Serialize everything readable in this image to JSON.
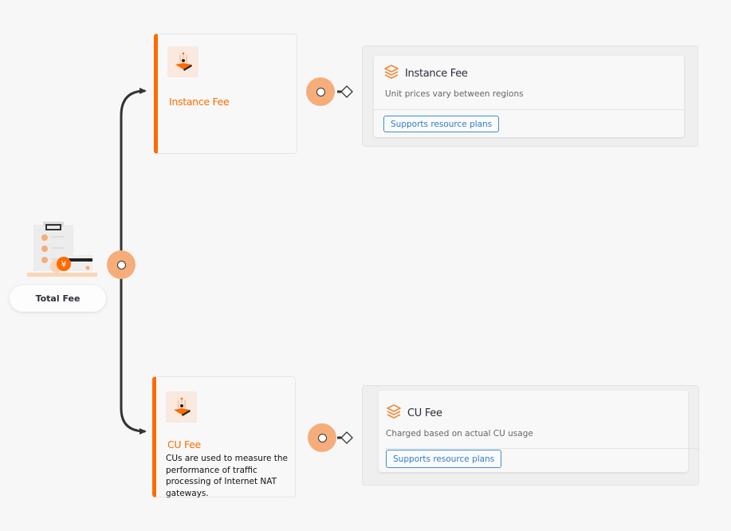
{
  "root": {
    "label": "Total Fee",
    "icon": "bill-payment-icon",
    "currency_symbol": "¥"
  },
  "colors": {
    "accent": "#ff6a00",
    "junction": "#f5ad7a",
    "line": "#333333",
    "link": "#2f7fc7",
    "icon_bg": "#f9e9df"
  },
  "branches": [
    {
      "card": {
        "title": "Instance Fee",
        "description": "",
        "icon": "instance-cube-icon"
      },
      "detail": {
        "title": "Instance Fee",
        "icon": "layers-icon",
        "description": "Unit prices vary between regions",
        "button_label": "Supports resource plans"
      }
    },
    {
      "card": {
        "title": "CU Fee",
        "description": "CUs are used to measure the performance of traffic processing of Internet NAT gateways.",
        "icon": "instance-cube-icon"
      },
      "detail": {
        "title": "CU Fee",
        "icon": "layers-icon",
        "description": "Charged based on actual CU usage",
        "button_label": "Supports resource plans"
      }
    }
  ]
}
